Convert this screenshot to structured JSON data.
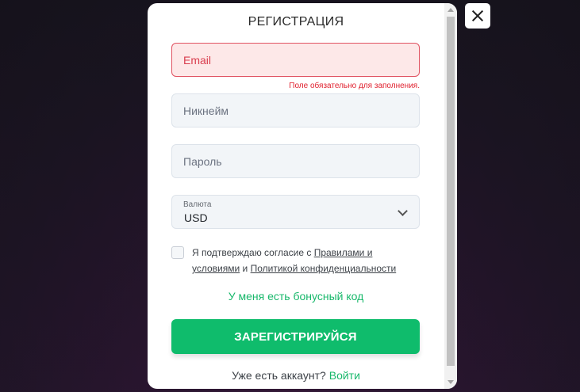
{
  "modal": {
    "title": "РЕГИСТРАЦИЯ"
  },
  "form": {
    "email": {
      "placeholder": "Email",
      "error": "Поле обязательно для заполнения."
    },
    "nickname": {
      "placeholder": "Никнейм"
    },
    "password": {
      "placeholder": "Пароль"
    },
    "currency": {
      "label": "Валюта",
      "value": "USD"
    }
  },
  "consent": {
    "prefix": "Я подтверждаю согласие с ",
    "rules_link": "Правилами и условиями",
    "and": " и ",
    "privacy_link": "Политикой конфиденциальности"
  },
  "bonus_link": "У меня есть бонусный код",
  "register_button": "ЗАРЕГИСТРИРУЙСЯ",
  "login": {
    "prompt": "Уже есть аккаунт? ",
    "link": "Войти"
  },
  "colors": {
    "accent": "#0fbc6c",
    "error": "#e0202e",
    "link": "#18b86b"
  },
  "icons": {
    "close": "close-icon",
    "chevron": "chevron-down-icon"
  }
}
